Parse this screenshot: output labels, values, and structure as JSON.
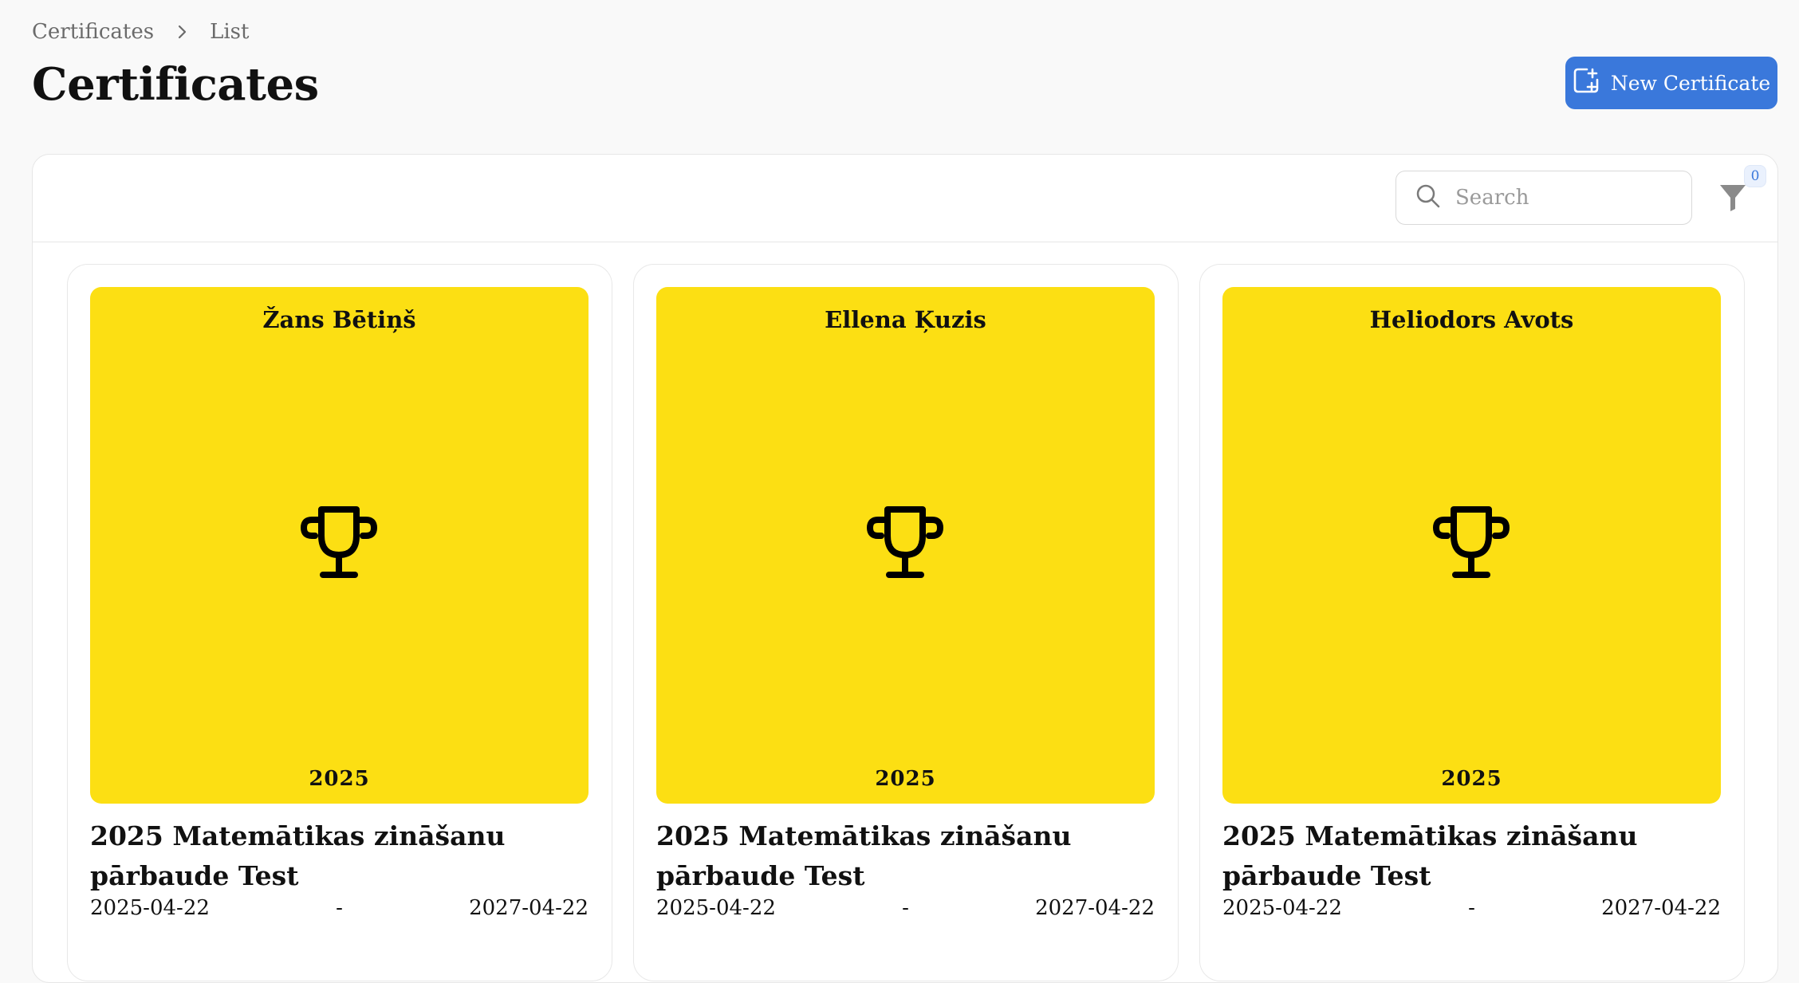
{
  "breadcrumb": {
    "items": [
      "Certificates",
      "List"
    ],
    "separator_icon": "chevron-right-icon"
  },
  "page": {
    "title": "Certificates"
  },
  "actions": {
    "new_certificate_label": "New Certificate",
    "new_certificate_icon": "new-document-plus-icon"
  },
  "toolbar": {
    "search_placeholder": "Search",
    "search_value": "",
    "filter_count": "0",
    "filter_icon": "funnel-icon"
  },
  "colors": {
    "accent": "#3a78db",
    "certificate_background": "#fcdf13",
    "page_background": "#f9f9f9"
  },
  "certificates": [
    {
      "recipient": "Žans Bētiņš",
      "year": "2025",
      "title": "2025 Matemātikas zināšanu pārbaude Test",
      "start_date": "2025-04-22",
      "separator": "-",
      "end_date": "2027-04-22",
      "icon": "trophy-icon"
    },
    {
      "recipient": "Ellena Ķuzis",
      "year": "2025",
      "title": "2025 Matemātikas zināšanu pārbaude Test",
      "start_date": "2025-04-22",
      "separator": "-",
      "end_date": "2027-04-22",
      "icon": "trophy-icon"
    },
    {
      "recipient": "Heliodors Avots",
      "year": "2025",
      "title": "2025 Matemātikas zināšanu pārbaude Test",
      "start_date": "2025-04-22",
      "separator": "-",
      "end_date": "2027-04-22",
      "icon": "trophy-icon"
    }
  ]
}
